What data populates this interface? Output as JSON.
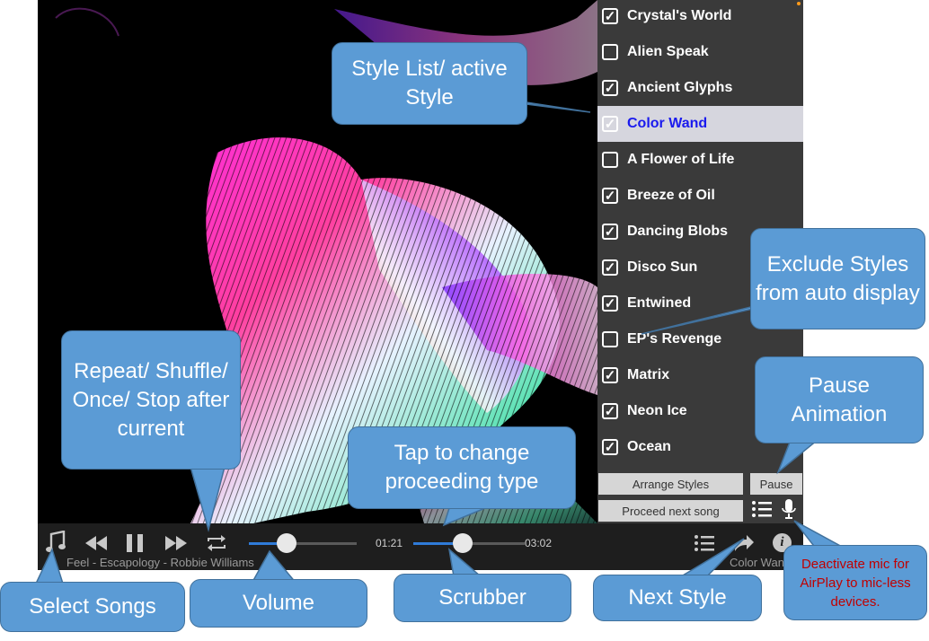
{
  "styles": [
    {
      "name": "Crystal's World",
      "checked": true
    },
    {
      "name": "Alien Speak",
      "checked": false
    },
    {
      "name": "Ancient Glyphs",
      "checked": true
    },
    {
      "name": "Color Wand",
      "checked": true,
      "active": true
    },
    {
      "name": "A Flower of Life",
      "checked": false
    },
    {
      "name": "Breeze of Oil",
      "checked": true
    },
    {
      "name": "Dancing Blobs",
      "checked": true
    },
    {
      "name": "Disco Sun",
      "checked": true
    },
    {
      "name": "Entwined",
      "checked": true
    },
    {
      "name": "EP's Revenge",
      "checked": false
    },
    {
      "name": "Matrix",
      "checked": true
    },
    {
      "name": "Neon Ice",
      "checked": true
    },
    {
      "name": "Ocean",
      "checked": true
    }
  ],
  "panel": {
    "arrange_label": "Arrange Styles",
    "pause_label": "Pause",
    "proceed_label": "Proceed next song",
    "list_icon": "list-icon",
    "mic_icon": "microphone-icon"
  },
  "player": {
    "now_playing": "Feel - Escapology - Robbie Williams",
    "elapsed": "01:21",
    "duration": "03:02",
    "current_style_short": "Color Wand",
    "volume_level": 0.35,
    "progress": 0.445,
    "icons": [
      "music-note-icon",
      "rewind-icon",
      "pause-icon",
      "fast-forward-icon",
      "repeat-icon",
      "list-icon",
      "share-arrow-icon",
      "info-icon"
    ]
  },
  "callouts": {
    "style_list": "Style List/ active Style",
    "exclude_styles": "Exclude Styles from auto display",
    "repeat": "Repeat/ Shuffle/ Once/ Stop after current",
    "pause_animation": "Pause Animation",
    "tap_change": "Tap to change proceeding type",
    "select_songs": "Select Songs",
    "volume": "Volume",
    "scrubber": "Scrubber",
    "next_style": "Next Style",
    "deactivate_mic": "Deactivate mic for AirPlay to mic-less devices."
  },
  "colors": {
    "callout_fill": "#5b9bd5",
    "callout_border": "#41719c",
    "active_style_text": "#1a1aee",
    "warning_text": "#c00000",
    "slider_fill": "#2f7bd8"
  }
}
